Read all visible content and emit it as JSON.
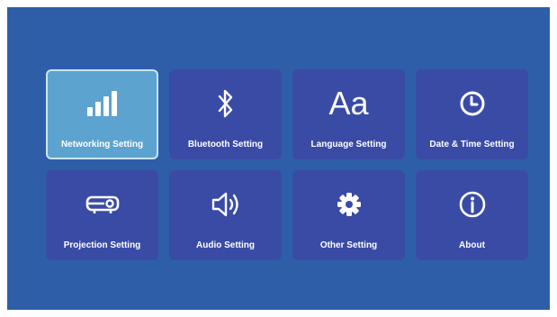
{
  "colors": {
    "screen_bg": "#2f5ea8",
    "tile_bg": "#3a4ba6",
    "tile_selected_bg": "#5da3cf",
    "tile_selected_border": "#c9e6f6",
    "text": "#ffffff"
  },
  "menu": {
    "selected_index": 0,
    "tiles": [
      {
        "label": "Networking Setting",
        "icon": "signal-bars-icon"
      },
      {
        "label": "Bluetooth Setting",
        "icon": "bluetooth-icon"
      },
      {
        "label": "Language Setting",
        "icon": "language-icon",
        "icon_text": "Aa"
      },
      {
        "label": "Date & Time Setting",
        "icon": "clock-icon"
      },
      {
        "label": "Projection Setting",
        "icon": "projector-icon"
      },
      {
        "label": "Audio Setting",
        "icon": "speaker-icon"
      },
      {
        "label": "Other Setting",
        "icon": "gear-icon"
      },
      {
        "label": "About",
        "icon": "info-icon"
      }
    ]
  }
}
